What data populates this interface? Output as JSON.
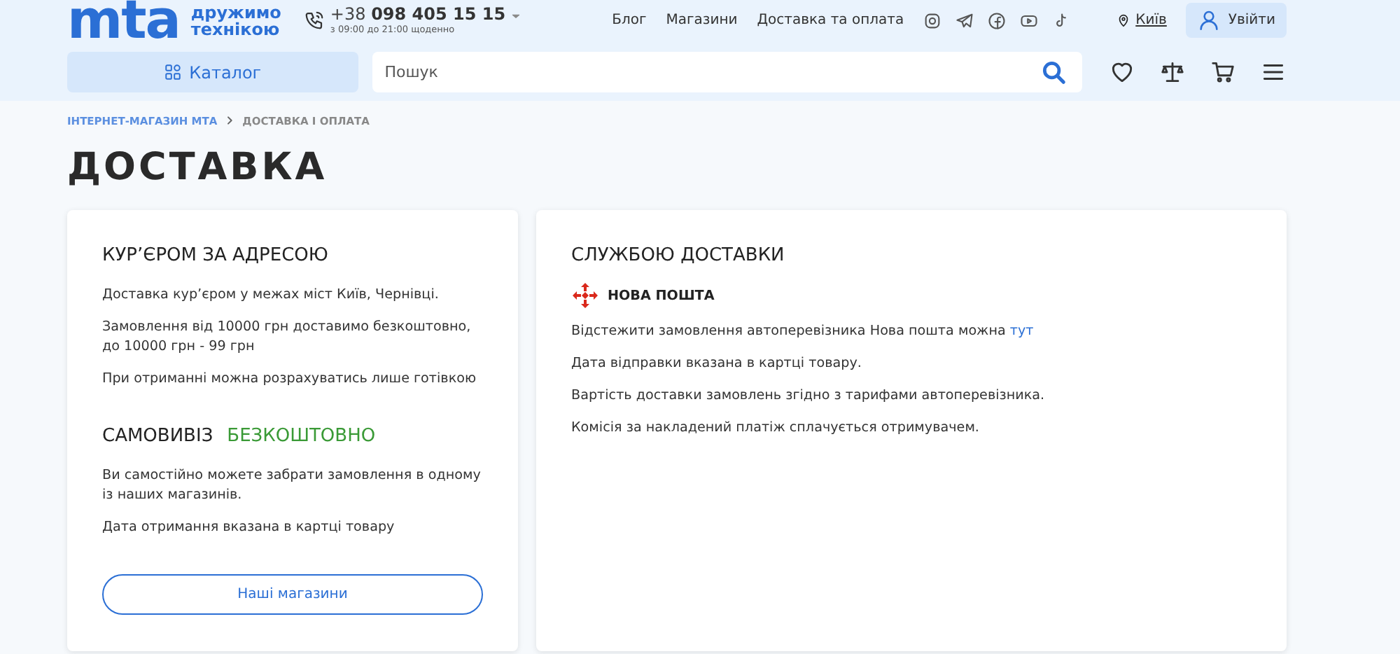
{
  "header": {
    "logo": "mta",
    "tagline": [
      "дружимо",
      "технікою"
    ],
    "phone_prefix": "+38",
    "phone": "098 405 15 15",
    "hours": "з 09:00 до 21:00 щоденно",
    "nav": [
      "Блог",
      "Магазини",
      "Доставка та оплата"
    ],
    "city": "Київ",
    "login": "Увійти",
    "catalog": "Каталог",
    "search": {
      "placeholder": "Пошук"
    }
  },
  "breadcrumbs": [
    {
      "label": "ІНТЕРНЕТ-МАГАЗИН МТА",
      "link": true
    },
    {
      "label": "ДОСТАВКА І ОПЛАТА",
      "link": false
    }
  ],
  "title": "ДОСТАВКА",
  "courier": {
    "heading": "КУР’ЄРОМ ЗА АДРЕСОЮ",
    "paragraphs": [
      "Доставка кур’єром у межах міст Київ, Чернівці.",
      "Замовлення від 10000 грн доставимо безкоштовно, до 10000 грн - 99 грн",
      "При отриманні можна розрахуватись лише готівкою"
    ]
  },
  "pickup": {
    "heading": "САМОВИВІЗ",
    "badge": "БЕЗКОШТОВНО",
    "paragraphs": [
      "Ви самостійно можете забрати замовлення в одному із наших магазинів.",
      "Дата отримання вказана в картці товару"
    ],
    "button": "Наші магазини"
  },
  "service": {
    "heading": "СЛУЖБОЮ ДОСТАВКИ",
    "carrier": "НОВА ПОШТА",
    "track_text": "Відстежити замовлення автоперевізника Нова пошта можна",
    "track_link": "тут",
    "paragraphs": [
      "Дата відправки вказана в картці товару.",
      "Вартість доставки замовлень згідно з тарифами автоперевізника.",
      "Комісія за накладений платіж сплачується отримувачем."
    ]
  }
}
